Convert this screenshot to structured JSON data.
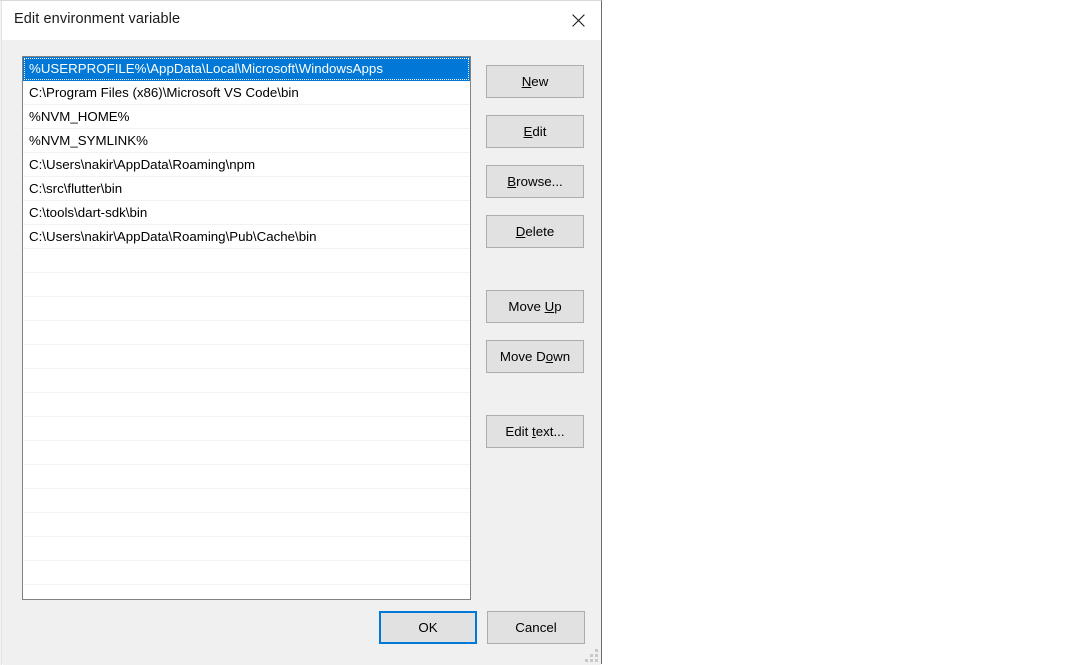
{
  "window": {
    "title": "Edit environment variable",
    "close_icon": "close-icon",
    "accent_color": "#0078d7",
    "dialog_background": "#f0f0f0",
    "titlebar_background": "#ffffff",
    "button_background": "#e1e1e1",
    "button_border": "#adadad"
  },
  "listbox": {
    "selected_index": 0,
    "empty_row_count": 14,
    "items": [
      {
        "value": "%USERPROFILE%\\AppData\\Local\\Microsoft\\WindowsApps"
      },
      {
        "value": "C:\\Program Files (x86)\\Microsoft VS Code\\bin"
      },
      {
        "value": "%NVM_HOME%"
      },
      {
        "value": "%NVM_SYMLINK%"
      },
      {
        "value": "C:\\Users\\nakir\\AppData\\Roaming\\npm"
      },
      {
        "value": "C:\\src\\flutter\\bin"
      },
      {
        "value": "C:\\tools\\dart-sdk\\bin"
      },
      {
        "value": "C:\\Users\\nakir\\AppData\\Roaming\\Pub\\Cache\\bin"
      }
    ]
  },
  "side_buttons": {
    "new": {
      "pre": "",
      "acc": "N",
      "post": "ew"
    },
    "edit": {
      "pre": "",
      "acc": "E",
      "post": "dit"
    },
    "browse": {
      "pre": "",
      "acc": "B",
      "post": "rowse..."
    },
    "delete": {
      "pre": "",
      "acc": "D",
      "post": "elete"
    },
    "move_up": {
      "pre": "Move ",
      "acc": "U",
      "post": "p"
    },
    "move_down": {
      "pre": "Move D",
      "acc": "o",
      "post": "wn"
    },
    "edit_text": {
      "pre": "Edit ",
      "acc": "t",
      "post": "ext..."
    }
  },
  "footer": {
    "ok_label": "OK",
    "cancel_label": "Cancel"
  }
}
